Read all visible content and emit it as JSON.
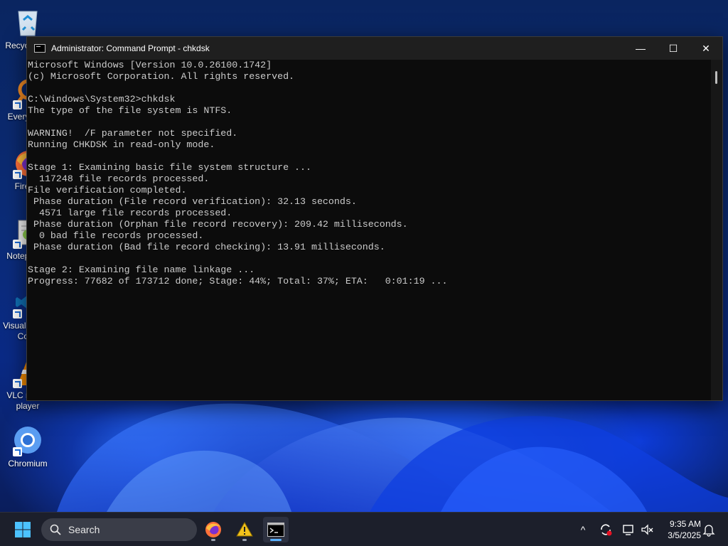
{
  "desktop": {
    "icons": [
      {
        "label": "Recycle Bin",
        "icon": "recycle-bin-icon"
      },
      {
        "label": "Everything",
        "icon": "everything-search-icon"
      },
      {
        "label": "Firefox",
        "icon": "firefox-icon"
      },
      {
        "label": "Notepad++",
        "icon": "notepadpp-icon"
      },
      {
        "label": "Visual Studio Code",
        "icon": "vscode-icon"
      },
      {
        "label": "VLC media player",
        "icon": "vlc-icon"
      },
      {
        "label": "Chromium",
        "icon": "chromium-icon"
      }
    ]
  },
  "window": {
    "title": "Administrator: Command Prompt - chkdsk",
    "minimize": "—",
    "maximize": "☐",
    "close": "✕"
  },
  "console": {
    "lines": [
      "Microsoft Windows [Version 10.0.26100.1742]",
      "(c) Microsoft Corporation. All rights reserved.",
      "",
      "C:\\Windows\\System32>chkdsk",
      "The type of the file system is NTFS.",
      "",
      "WARNING!  /F parameter not specified.",
      "Running CHKDSK in read-only mode.",
      "",
      "Stage 1: Examining basic file system structure ...",
      "  117248 file records processed.",
      "File verification completed.",
      " Phase duration (File record verification): 32.13 seconds.",
      "  4571 large file records processed.",
      " Phase duration (Orphan file record recovery): 209.42 milliseconds.",
      "  0 bad file records processed.",
      " Phase duration (Bad file record checking): 13.91 milliseconds.",
      "",
      "Stage 2: Examining file name linkage ...",
      "Progress: 77682 of 173712 done; Stage: 44%; Total: 37%; ETA:   0:01:19 ..."
    ]
  },
  "taskbar": {
    "search_placeholder": "Search",
    "pinned": [
      {
        "name": "firefox-taskbar-icon"
      },
      {
        "name": "warning-app-taskbar-icon"
      },
      {
        "name": "command-prompt-taskbar-icon",
        "active": true
      }
    ],
    "tray": {
      "overflow": "^",
      "time": "9:35 AM",
      "date": "3/5/2025"
    }
  },
  "colors": {
    "console_bg": "#0c0c0c",
    "console_text": "#cccccc",
    "title_bar": "#1f1f1f",
    "taskbar": "#1c1f2b",
    "accent": "#5ab1ff"
  }
}
